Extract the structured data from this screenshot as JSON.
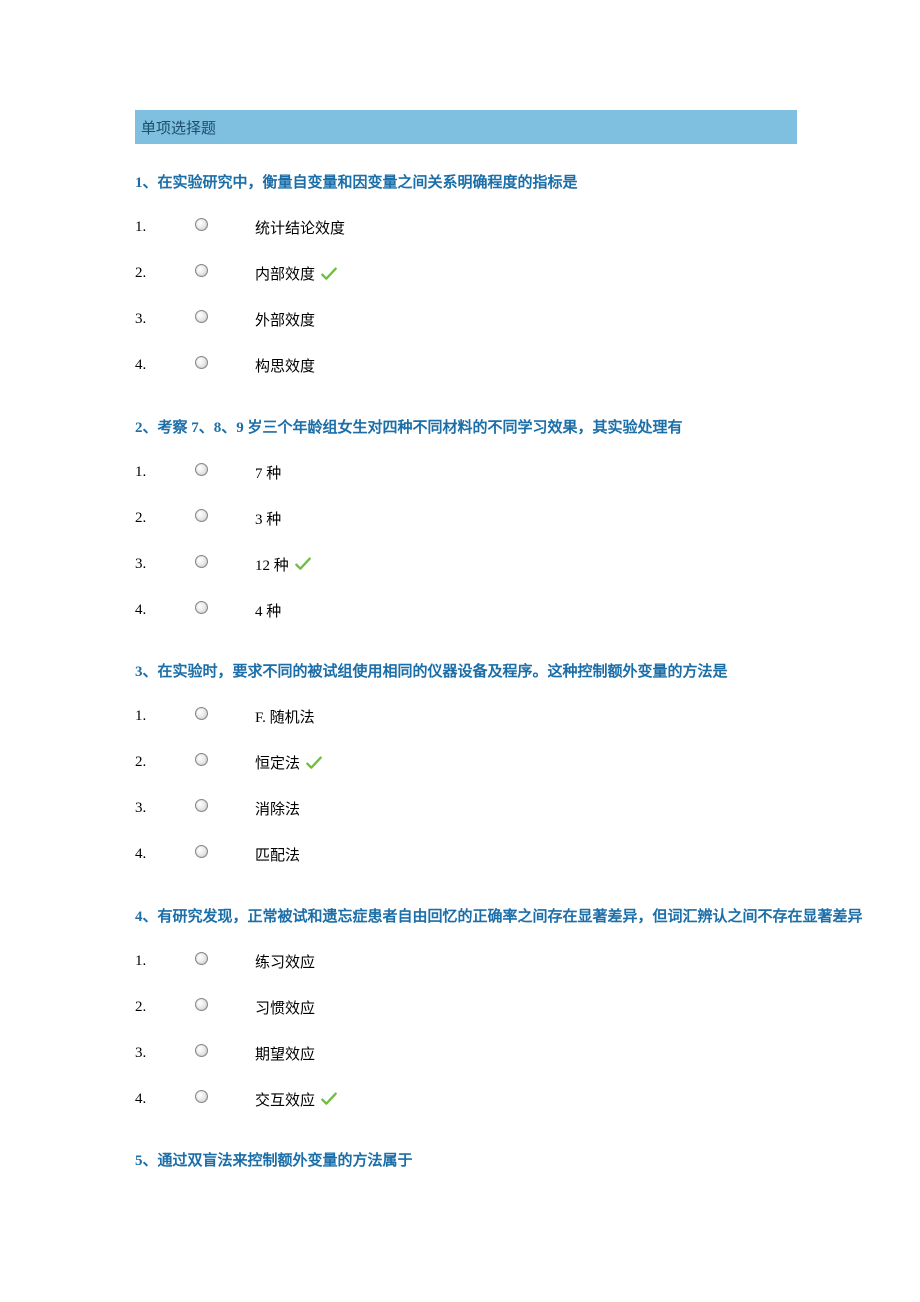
{
  "section_header": "单项选择题",
  "questions": [
    {
      "title": "1、在实验研究中，衡量自变量和因变量之间关系明确程度的指标是",
      "options": [
        {
          "num": "1.",
          "text": "统计结论效度",
          "correct": false
        },
        {
          "num": "2.",
          "text": "内部效度",
          "correct": true
        },
        {
          "num": "3.",
          "text": "外部效度",
          "correct": false
        },
        {
          "num": "4.",
          "text": "构思效度",
          "correct": false
        }
      ]
    },
    {
      "title": "2、考察 7、8、9 岁三个年龄组女生对四种不同材料的不同学习效果，其实验处理有",
      "options": [
        {
          "num": "1.",
          "text": "7 种",
          "correct": false
        },
        {
          "num": "2.",
          "text": "3 种",
          "correct": false
        },
        {
          "num": "3.",
          "text": "12 种",
          "correct": true
        },
        {
          "num": "4.",
          "text": "4 种",
          "correct": false
        }
      ]
    },
    {
      "title": "3、在实验时，要求不同的被试组使用相同的仪器设备及程序。这种控制额外变量的方法是",
      "options": [
        {
          "num": "1.",
          "text": "F.  随机法",
          "correct": false
        },
        {
          "num": "2.",
          "text": "恒定法",
          "correct": true
        },
        {
          "num": "3.",
          "text": "消除法",
          "correct": false
        },
        {
          "num": "4.",
          "text": "匹配法",
          "correct": false
        }
      ]
    },
    {
      "title": "4、有研究发现，正常被试和遗忘症患者自由回忆的正确率之间存在显著差异，但词汇辨认之间不存在显著差异",
      "options": [
        {
          "num": "1.",
          "text": "练习效应",
          "correct": false
        },
        {
          "num": "2.",
          "text": "习惯效应",
          "correct": false
        },
        {
          "num": "3.",
          "text": "期望效应",
          "correct": false
        },
        {
          "num": "4.",
          "text": "交互效应",
          "correct": true
        }
      ]
    },
    {
      "title": "5、通过双盲法来控制额外变量的方法属于",
      "options": []
    }
  ]
}
